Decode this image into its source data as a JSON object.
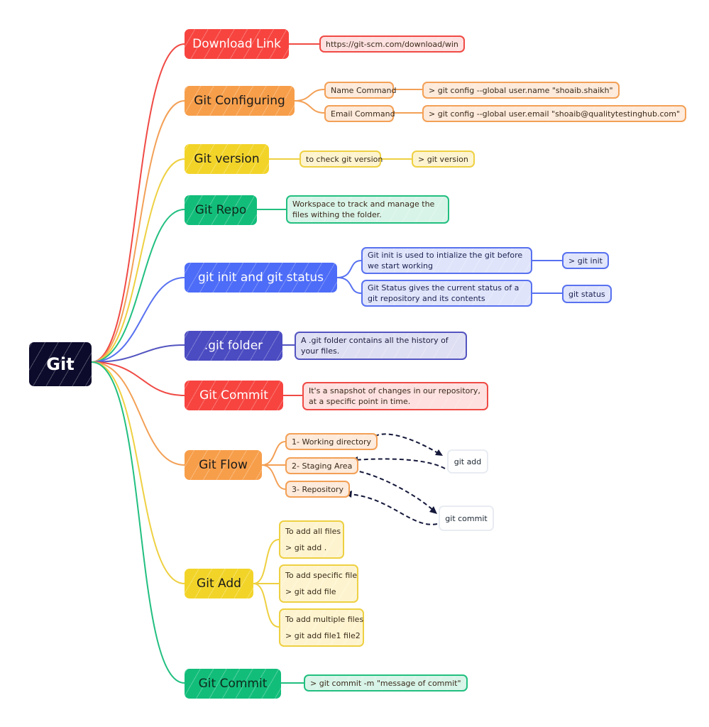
{
  "root": {
    "label": "Git",
    "color": "#0c0b2b"
  },
  "branches": [
    {
      "label": "Download Link",
      "color": "#f7443f",
      "children": [
        "https://git-scm.com/download/win"
      ]
    },
    {
      "label": "Git Configuring",
      "color": "#f79e4a",
      "children": [
        {
          "label": "Name Command",
          "command": "> git config --global user.name \"shoaib.shaikh\""
        },
        {
          "label": "Email Command",
          "command": "> git config --global user.email \"shoaib@qualitytestinghub.com\""
        }
      ]
    },
    {
      "label": "Git version",
      "color": "#f2d429",
      "children": [
        {
          "label": "to check git version",
          "command": "> git version"
        }
      ]
    },
    {
      "label": "Git Repo",
      "color": "#12bd7a",
      "children": [
        "Workspace to track and manage the files withing the folder."
      ]
    },
    {
      "label": "git init and git status",
      "color": "#4d6cf7",
      "children": [
        {
          "label": "Git init is used to intialize the git before we start working",
          "command": "> git init"
        },
        {
          "label": "Git Status gives the current status of a git repository and its contents",
          "command": "git status"
        }
      ]
    },
    {
      "label": ".git folder",
      "color": "#4b4bc2",
      "children": [
        "A .git folder contains all the history of your files."
      ]
    },
    {
      "label": "Git Commit",
      "color": "#f7443f",
      "children": [
        "It's a snapshot of changes in our repository, at a specific point in time."
      ]
    },
    {
      "label": "Git Flow",
      "color": "#f79e4a",
      "children": [
        "1- Working directory",
        "2- Staging Area",
        "3- Repository"
      ],
      "annotations": [
        "git add",
        "git commit"
      ]
    },
    {
      "label": "Git Add",
      "color": "#f2d429",
      "children": [
        {
          "title": "To add all files",
          "command": "> git add ."
        },
        {
          "title": "To add specific file",
          "command": "> git add file"
        },
        {
          "title": "To add multiple files",
          "command": "> git add file1 file2"
        }
      ]
    },
    {
      "label": "Git Commit",
      "color": "#12bd7a",
      "children": [
        "> git commit -m \"message of commit\""
      ]
    }
  ]
}
